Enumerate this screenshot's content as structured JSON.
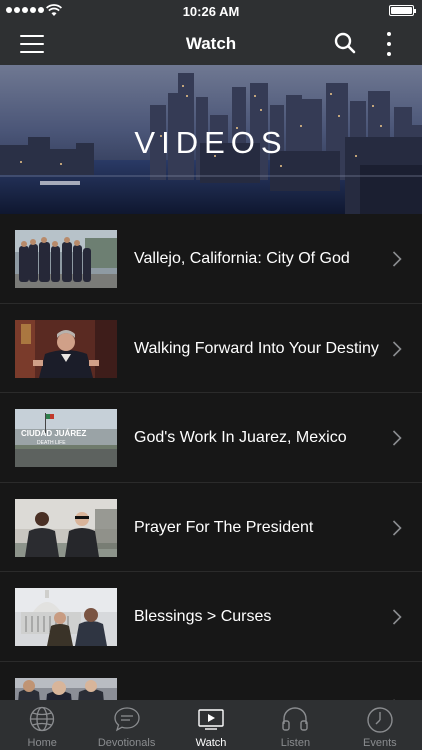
{
  "status_bar": {
    "time": "10:26 AM"
  },
  "nav": {
    "title": "Watch"
  },
  "hero": {
    "title": "VIDEOS"
  },
  "videos": [
    {
      "title": "Vallejo, California: City Of God"
    },
    {
      "title": "Walking Forward Into Your Destiny"
    },
    {
      "title": "God's Work In Juarez, Mexico",
      "thumb_caption": "CIUDAD JUÁREZ",
      "thumb_subcaption": "DEATH   LIFE"
    },
    {
      "title": "Prayer For The President"
    },
    {
      "title": "Blessings > Curses"
    },
    {
      "title": ""
    }
  ],
  "tabs": [
    {
      "label": "Home",
      "icon": "globe-icon",
      "active": false
    },
    {
      "label": "Devotionals",
      "icon": "chat-bubble-icon",
      "active": false
    },
    {
      "label": "Watch",
      "icon": "video-screen-icon",
      "active": true
    },
    {
      "label": "Listen",
      "icon": "headphones-icon",
      "active": false
    },
    {
      "label": "Events",
      "icon": "clock-icon",
      "active": false
    }
  ],
  "colors": {
    "bar": "#2e3032",
    "background": "#171717",
    "active_tab": "#ffffff",
    "inactive_tab": "#8a8c8f"
  }
}
